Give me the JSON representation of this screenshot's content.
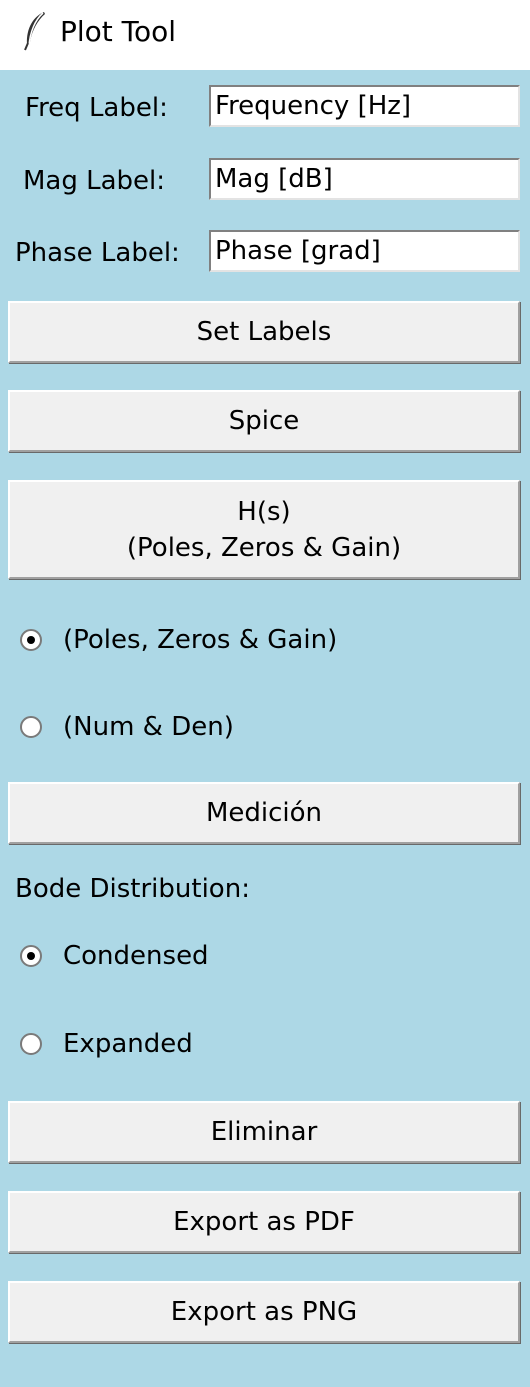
{
  "window": {
    "title": "Plot Tool",
    "icon": "feather-icon"
  },
  "labels": {
    "freq_label": "Freq Label:",
    "freq_value": "Frequency [Hz]",
    "mag_label": "Mag Label:",
    "mag_value": "Mag [dB]",
    "phase_label": "Phase Label:",
    "phase_value": "Phase [grad]"
  },
  "buttons": {
    "set_labels": "Set Labels",
    "spice": "Spice",
    "hs_line1": "H(s)",
    "hs_line2": "(Poles, Zeros & Gain)",
    "medicion": "Medición",
    "eliminar": "Eliminar",
    "export_pdf": "Export as PDF",
    "export_png": "Export as PNG"
  },
  "hs_mode": {
    "options": [
      "(Poles, Zeros & Gain)",
      "(Num & Den)"
    ],
    "selected": "(Poles, Zeros & Gain)"
  },
  "bode": {
    "heading": "Bode Distribution:",
    "options": [
      "Condensed",
      "Expanded"
    ],
    "selected": "Condensed"
  },
  "colors": {
    "background": "#add8e6",
    "button_face": "#f0f0f0",
    "titlebar": "#ffffff"
  }
}
